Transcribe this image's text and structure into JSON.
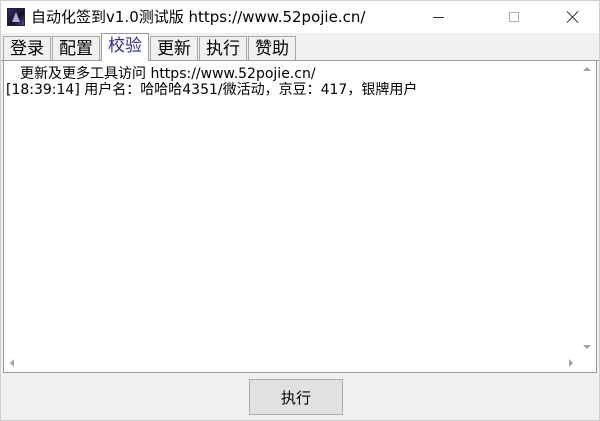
{
  "window": {
    "title": "自动化签到v1.0测试版  https://www.52pojie.cn/",
    "icon": "app-logo-icon"
  },
  "controls": {
    "minimize_icon": "minimize-icon",
    "maximize_icon": "maximize-icon",
    "close_icon": "close-icon"
  },
  "tabs": [
    {
      "label": "登录",
      "active": false
    },
    {
      "label": "配置",
      "active": false
    },
    {
      "label": "校验",
      "active": true
    },
    {
      "label": "更新",
      "active": false
    },
    {
      "label": "执行",
      "active": false
    },
    {
      "label": "赞助",
      "active": false
    }
  ],
  "log": {
    "lines": [
      "更新及更多工具访问 https://www.52pojie.cn/",
      "[18:39:14] 用户名：哈哈哈4351/微活动，京豆：417，银牌用户"
    ]
  },
  "footer": {
    "execute_label": "执行"
  },
  "colors": {
    "active_tab_text": "#2a2aa0",
    "window_bg": "#f0f0f0",
    "log_bg": "#ffffff"
  }
}
